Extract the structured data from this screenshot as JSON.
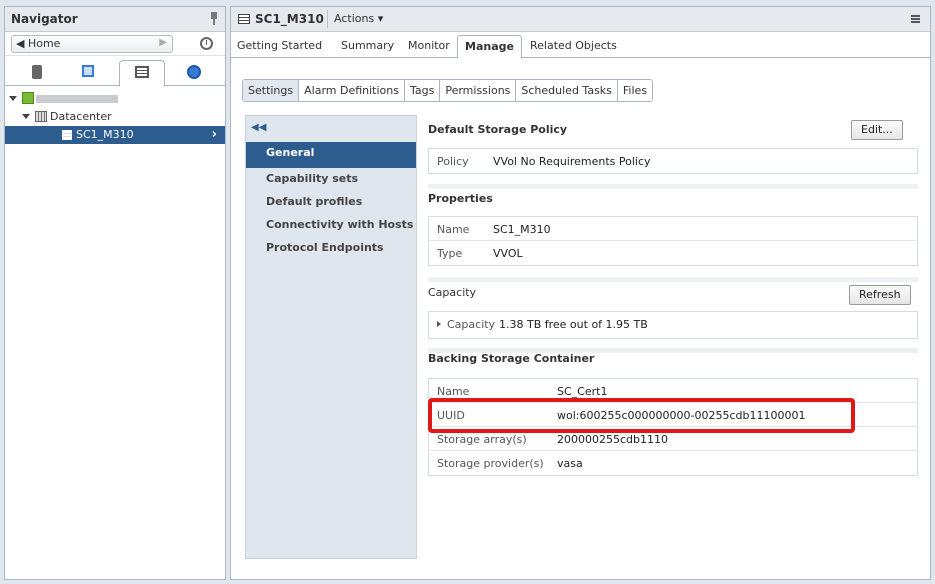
{
  "navigator": {
    "title": "Navigator",
    "home_label": "Home",
    "tree": {
      "datacenter_label": "Datacenter",
      "selected_label": "SC1_M310"
    }
  },
  "main": {
    "object_title": "SC1_M310",
    "actions_label": "Actions",
    "tabs": [
      "Getting Started",
      "Summary",
      "Monitor",
      "Manage",
      "Related Objects"
    ],
    "active_tab": "Manage",
    "subtabs": [
      "Settings",
      "Alarm Definitions",
      "Tags",
      "Permissions",
      "Scheduled Tasks",
      "Files"
    ],
    "active_subtab": "Settings",
    "settings_nav": [
      "General",
      "Capability sets",
      "Default profiles",
      "Connectivity with Hosts",
      "Protocol Endpoints"
    ],
    "default_policy": {
      "heading": "Default Storage Policy",
      "edit_label": "Edit...",
      "policy_label": "Policy",
      "policy_value": "VVol No Requirements Policy"
    },
    "properties": {
      "heading": "Properties",
      "name_label": "Name",
      "name_value": "SC1_M310",
      "type_label": "Type",
      "type_value": "VVOL"
    },
    "capacity": {
      "heading": "Capacity",
      "refresh_label": "Refresh",
      "label": "Capacity",
      "value": "1.38 TB free out of 1.95 TB"
    },
    "backing": {
      "heading": "Backing Storage Container",
      "rows": [
        {
          "label": "Name",
          "value": "SC_Cert1"
        },
        {
          "label": "UUID",
          "value": "wol:600255c000000000-00255cdb11100001"
        },
        {
          "label": "Storage array(s)",
          "value": "200000255cdb1110"
        },
        {
          "label": "Storage provider(s)",
          "value": "vasa"
        }
      ]
    }
  },
  "colors": {
    "selection_blue": "#2c5d8e",
    "highlight_red": "#e01818"
  }
}
